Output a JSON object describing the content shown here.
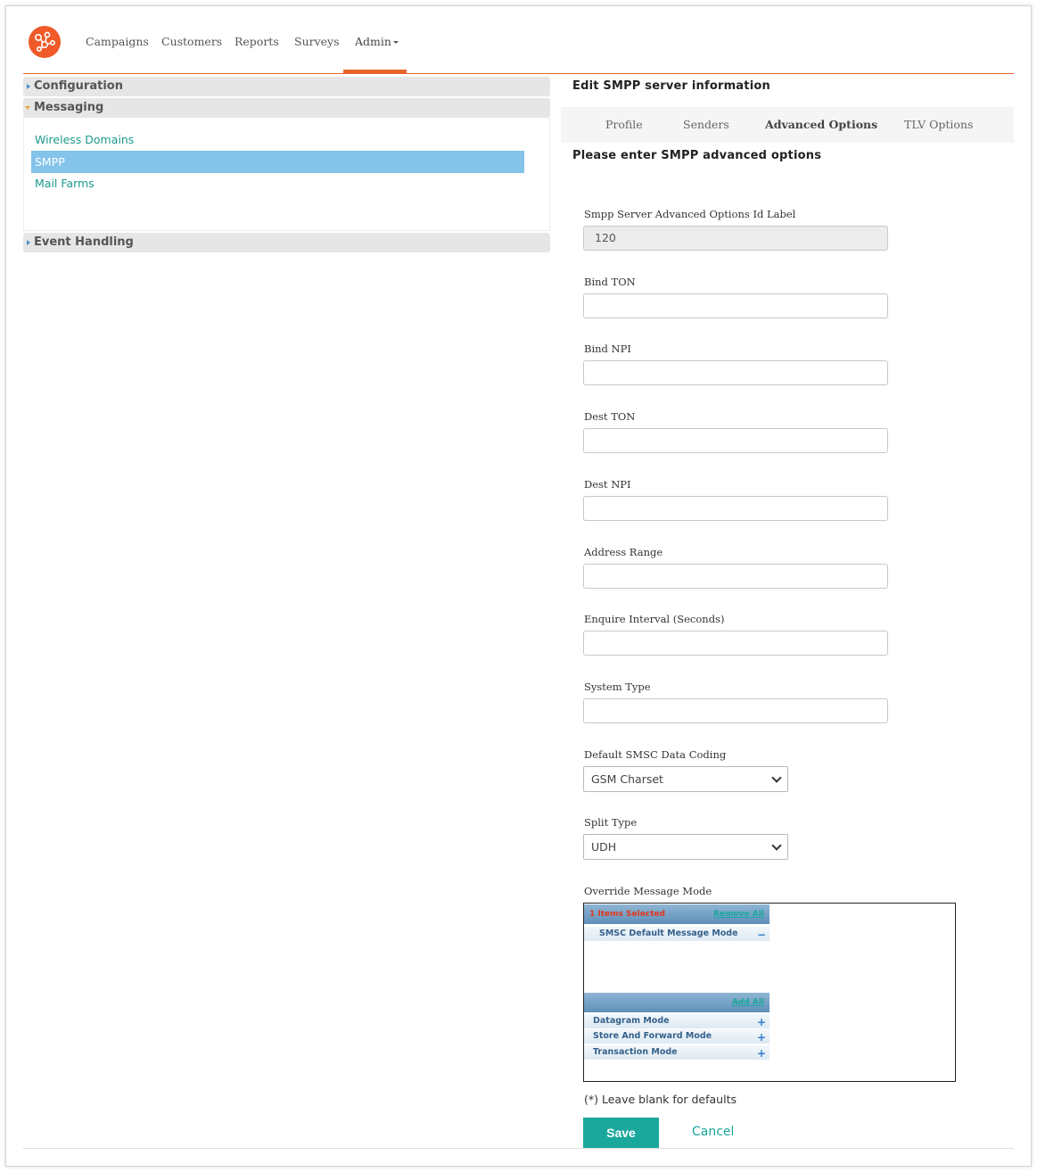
{
  "nav": {
    "items": [
      {
        "label": "Campaigns"
      },
      {
        "label": "Customers"
      },
      {
        "label": "Reports"
      },
      {
        "label": "Surveys"
      },
      {
        "label": "Admin"
      }
    ],
    "active": "Admin",
    "brand_color": "#ef5a28"
  },
  "sidebar": {
    "sections": [
      {
        "label": "Configuration",
        "expanded": false
      },
      {
        "label": "Messaging",
        "expanded": true
      },
      {
        "label": "Event Handling",
        "expanded": false
      }
    ],
    "messaging_items": [
      {
        "label": "Wireless Domains"
      },
      {
        "label": "SMPP",
        "selected": true
      },
      {
        "label": "Mail Farms"
      }
    ]
  },
  "main": {
    "title": "Edit SMPP server information",
    "tabs": [
      {
        "label": "Profile"
      },
      {
        "label": "Senders"
      },
      {
        "label": "Advanced Options",
        "active": true
      },
      {
        "label": "TLV Options"
      }
    ],
    "section_title": "Please enter SMPP advanced options"
  },
  "form": {
    "id_label": {
      "label": "Smpp Server Advanced Options Id Label",
      "value": "120"
    },
    "bind_ton": {
      "label": "Bind TON",
      "value": ""
    },
    "bind_npi": {
      "label": "Bind NPI",
      "value": ""
    },
    "dest_ton": {
      "label": "Dest TON",
      "value": ""
    },
    "dest_npi": {
      "label": "Dest NPI",
      "value": ""
    },
    "address_range": {
      "label": "Address Range",
      "value": ""
    },
    "enquire_interval": {
      "label": "Enquire Interval (Seconds)",
      "value": ""
    },
    "system_type": {
      "label": "System Type",
      "value": ""
    },
    "data_coding": {
      "label": "Default SMSC Data Coding",
      "value": "GSM Charset"
    },
    "split_type": {
      "label": "Split Type",
      "value": "UDH"
    },
    "override_mode": {
      "label": "Override Message Mode",
      "selected_count": "1 Items Selected",
      "remove_all": "Remove All",
      "add_all": "Add All",
      "selected": [
        {
          "label": "SMSC Default Message Mode"
        }
      ],
      "available": [
        {
          "label": "Datagram Mode"
        },
        {
          "label": "Store And Forward Mode"
        },
        {
          "label": "Transaction Mode"
        }
      ]
    },
    "hint": "(*) Leave blank for defaults",
    "save_label": "Save",
    "cancel_label": "Cancel"
  },
  "colors": {
    "accent": "#1aa79c",
    "nav_accent": "#e8642c",
    "selected_row": "#84c3ea"
  }
}
